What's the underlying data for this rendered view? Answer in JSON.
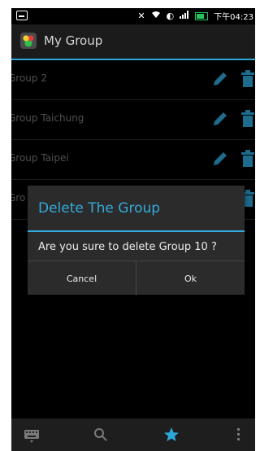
{
  "status_bar": {
    "time": "下午04:23"
  },
  "app_bar": {
    "title": "My Group"
  },
  "groups": [
    {
      "label": "Group 2"
    },
    {
      "label": "Group Taichung"
    },
    {
      "label": "Group Taipei"
    },
    {
      "label": "Gro"
    }
  ],
  "dialog": {
    "title": "Delete The Group",
    "message": "Are you sure to delete Group 10 ?",
    "cancel_label": "Cancel",
    "ok_label": "Ok"
  },
  "bottom_nav": [
    "keyboard-icon",
    "search-icon",
    "star-icon",
    "overflow-menu-icon"
  ],
  "colors": {
    "accent": "#2ea7d9",
    "bg": "#000000",
    "muted_text": "#7a7a7a"
  }
}
